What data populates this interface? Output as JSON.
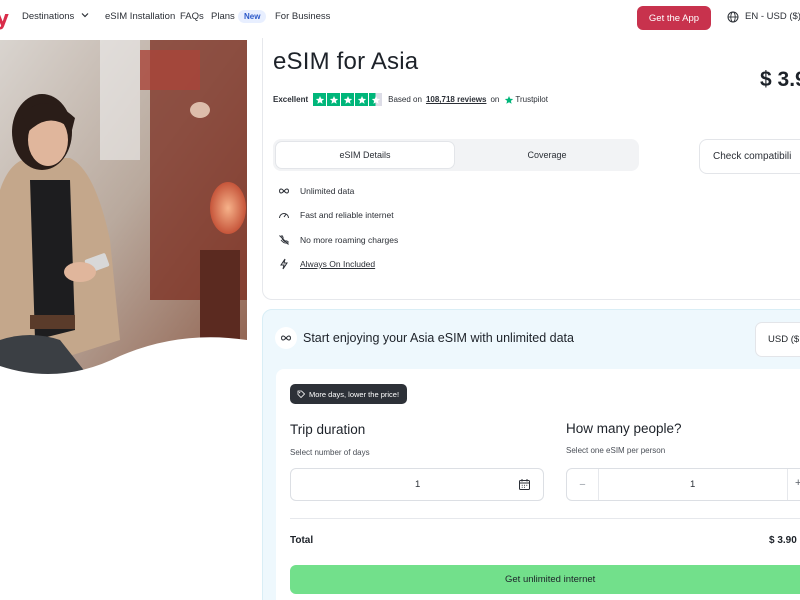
{
  "nav": {
    "logo_fragment": "y",
    "items": [
      "Destinations",
      "eSIM Installation",
      "FAQs",
      "Plans",
      "For Business"
    ],
    "new_badge": "New",
    "cta": "Get the App",
    "locale": "EN - USD ($)"
  },
  "product": {
    "title": "eSIM for Asia",
    "price": "$ 3.9",
    "rating_label": "Excellent",
    "reviews_prefix": "Based on",
    "reviews_count": "108,718 reviews",
    "reviews_suffix": "on",
    "trustpilot": "Trustpilot",
    "stars": 4.5,
    "tabs": [
      "eSIM Details",
      "Coverage"
    ],
    "check_compatibility": "Check compatibili",
    "features": [
      {
        "icon": "infinity-icon",
        "label": "Unlimited data"
      },
      {
        "icon": "speedometer-icon",
        "label": "Fast and reliable internet"
      },
      {
        "icon": "no-roaming-icon",
        "label": "No more roaming charges"
      },
      {
        "icon": "lightning-icon",
        "label": "Always On Included"
      }
    ]
  },
  "purchase": {
    "heading": "Start enjoying your Asia eSIM with unlimited data",
    "currency": "USD ($",
    "promo": "More days, lower the price!",
    "trip": {
      "title": "Trip duration",
      "subtitle": "Select number of days",
      "value": "1"
    },
    "people": {
      "title": "How many people?",
      "subtitle": "Select one eSIM per person",
      "value": "1",
      "minus": "−",
      "plus": "+"
    },
    "total_label": "Total",
    "total_value": "$ 3.90",
    "cta": "Get unlimited internet"
  },
  "colors": {
    "brand": "#c8324d",
    "trustpilot": "#00b67a",
    "cta": "#72e08b",
    "panel": "#eef8fd"
  }
}
